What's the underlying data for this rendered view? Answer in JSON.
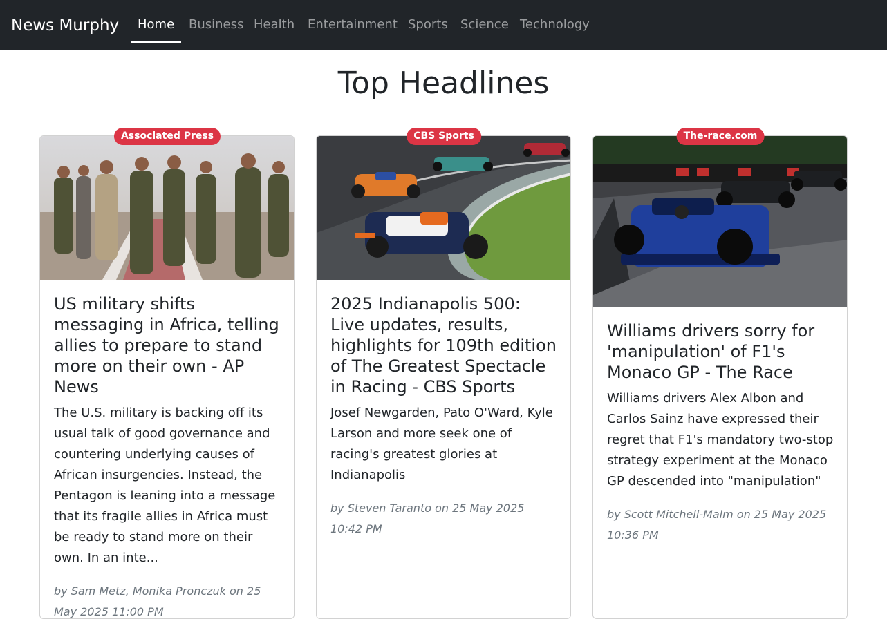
{
  "brand": "News Murphy",
  "nav": [
    "Home",
    "Business",
    "Health",
    "Entertainment",
    "Sports",
    "Science",
    "Technology"
  ],
  "active_nav": "Home",
  "page_title": "Top Headlines",
  "articles": [
    {
      "source": "Associated Press",
      "title": "US military shifts messaging in Africa, telling allies to prepare to stand more on their own - AP News",
      "description": "The U.S. military is backing off its usual talk of good governance and countering underlying causes of African insurgencies. Instead, the Pentagon is leaning into a message that its fragile allies in Africa must be ready to stand more on their own. In an inte...",
      "byline": "by Sam Metz, Monika Pronczuk on 25 May 2025 11:00 PM",
      "image": "military-officials-walking-photo"
    },
    {
      "source": "CBS Sports",
      "title": "2025 Indianapolis 500: Live updates, results, highlights for 109th edition of The Greatest Spectacle in Racing - CBS Sports",
      "description": "Josef Newgarden, Pato O'Ward, Kyle Larson and more seek one of racing's greatest glories at Indianapolis",
      "byline": "by Steven Taranto on 25 May 2025 10:42 PM",
      "image": "indycar-race-photo"
    },
    {
      "source": "The-race.com",
      "title": "Williams drivers sorry for 'manipulation' of F1's Monaco GP - The Race",
      "description": "Williams drivers Alex Albon and Carlos Sainz have expressed their regret that F1's mandatory two-stop strategy experiment at the Monaco GP descended into \"manipulation\"",
      "byline": "by Scott Mitchell-Malm on 25 May 2025 10:36 PM",
      "image": "f1-car-monaco-photo"
    }
  ]
}
